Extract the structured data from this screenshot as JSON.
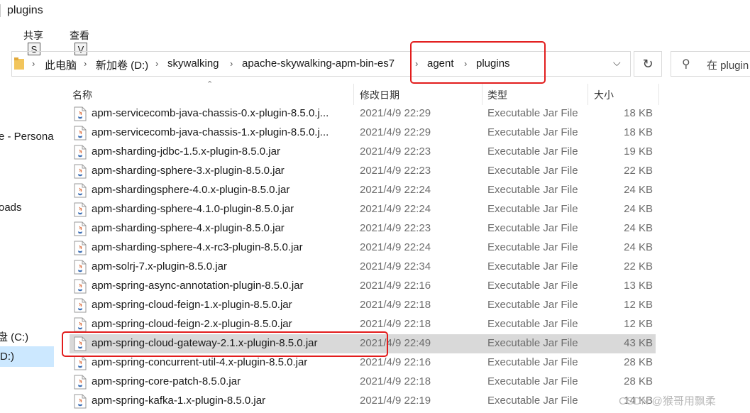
{
  "window": {
    "title": "plugins"
  },
  "ribbon": {
    "tabs": [
      {
        "label": "共享",
        "keytip": "S"
      },
      {
        "label": "查看",
        "keytip": "V"
      }
    ]
  },
  "address": {
    "crumbs": [
      "此电脑",
      "新加卷 (D:)",
      "skywalking",
      "apache-skywalking-apm-bin-es7",
      "agent",
      "plugins"
    ]
  },
  "search": {
    "placeholder": "在 plugin"
  },
  "nav": {
    "items": [
      "e - Persona",
      "oads",
      "盘 (C:)",
      "D:)"
    ]
  },
  "columns": {
    "name": "名称",
    "date": "修改日期",
    "type": "类型",
    "size": "大小"
  },
  "files": [
    {
      "name": "apm-servicecomb-java-chassis-0.x-plugin-8.5.0.j...",
      "date": "2021/4/9 22:29",
      "type": "Executable Jar File",
      "size": "18 KB"
    },
    {
      "name": "apm-servicecomb-java-chassis-1.x-plugin-8.5.0.j...",
      "date": "2021/4/9 22:29",
      "type": "Executable Jar File",
      "size": "18 KB"
    },
    {
      "name": "apm-sharding-jdbc-1.5.x-plugin-8.5.0.jar",
      "date": "2021/4/9 22:23",
      "type": "Executable Jar File",
      "size": "19 KB"
    },
    {
      "name": "apm-sharding-sphere-3.x-plugin-8.5.0.jar",
      "date": "2021/4/9 22:23",
      "type": "Executable Jar File",
      "size": "22 KB"
    },
    {
      "name": "apm-shardingsphere-4.0.x-plugin-8.5.0.jar",
      "date": "2021/4/9 22:24",
      "type": "Executable Jar File",
      "size": "24 KB"
    },
    {
      "name": "apm-sharding-sphere-4.1.0-plugin-8.5.0.jar",
      "date": "2021/4/9 22:24",
      "type": "Executable Jar File",
      "size": "24 KB"
    },
    {
      "name": "apm-sharding-sphere-4.x-plugin-8.5.0.jar",
      "date": "2021/4/9 22:23",
      "type": "Executable Jar File",
      "size": "24 KB"
    },
    {
      "name": "apm-sharding-sphere-4.x-rc3-plugin-8.5.0.jar",
      "date": "2021/4/9 22:24",
      "type": "Executable Jar File",
      "size": "24 KB"
    },
    {
      "name": "apm-solrj-7.x-plugin-8.5.0.jar",
      "date": "2021/4/9 22:34",
      "type": "Executable Jar File",
      "size": "22 KB"
    },
    {
      "name": "apm-spring-async-annotation-plugin-8.5.0.jar",
      "date": "2021/4/9 22:16",
      "type": "Executable Jar File",
      "size": "13 KB"
    },
    {
      "name": "apm-spring-cloud-feign-1.x-plugin-8.5.0.jar",
      "date": "2021/4/9 22:18",
      "type": "Executable Jar File",
      "size": "12 KB"
    },
    {
      "name": "apm-spring-cloud-feign-2.x-plugin-8.5.0.jar",
      "date": "2021/4/9 22:18",
      "type": "Executable Jar File",
      "size": "12 KB"
    },
    {
      "name": "apm-spring-cloud-gateway-2.1.x-plugin-8.5.0.jar",
      "date": "2021/4/9 22:49",
      "type": "Executable Jar File",
      "size": "43 KB",
      "selected": true
    },
    {
      "name": "apm-spring-concurrent-util-4.x-plugin-8.5.0.jar",
      "date": "2021/4/9 22:16",
      "type": "Executable Jar File",
      "size": "28 KB"
    },
    {
      "name": "apm-spring-core-patch-8.5.0.jar",
      "date": "2021/4/9 22:18",
      "type": "Executable Jar File",
      "size": "28 KB"
    },
    {
      "name": "apm-spring-kafka-1.x-plugin-8.5.0.jar",
      "date": "2021/4/9 22:19",
      "type": "Executable Jar File",
      "size": "14 KB"
    }
  ],
  "watermark": "CSDN @猴哥用飘柔",
  "colors": {
    "highlight_box": "#e21d1d",
    "selected_row": "#d9d9d9",
    "nav_selected": "#cce8ff"
  },
  "icons": {
    "folder": "folder-icon",
    "jar": "java-jar-file-icon",
    "refresh": "refresh-icon",
    "search": "search-icon"
  }
}
